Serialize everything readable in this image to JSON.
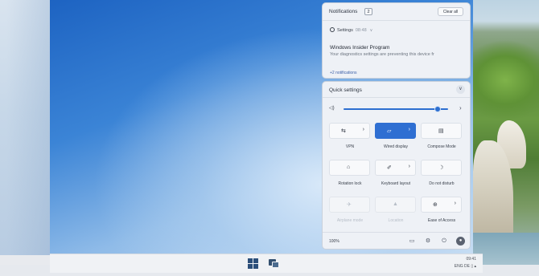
{
  "notifications": {
    "title": "Notifications",
    "count": "2",
    "clear_all": "Clear all",
    "app_name": "Settings",
    "app_time": "08:48",
    "item_title": "Windows Insider Program",
    "item_body": "Your diagnostics settings are preventing this device fr",
    "more": "+2 notifications"
  },
  "quick_settings": {
    "title": "Quick settings",
    "volume_percent": 90,
    "tiles": [
      {
        "name": "vpn",
        "label": "VPN",
        "icon": "shield-icon",
        "glyph": "⇆",
        "has_arrow": true,
        "active": false,
        "disabled": false
      },
      {
        "name": "wired-display",
        "label": "Wired display",
        "icon": "cast-icon",
        "glyph": "▱",
        "has_arrow": true,
        "active": true,
        "disabled": false
      },
      {
        "name": "compose-mode",
        "label": "Compose Mode",
        "icon": "compose-icon",
        "glyph": "▤",
        "has_arrow": false,
        "active": false,
        "disabled": false
      },
      {
        "name": "rotation-lock",
        "label": "Rotation lock",
        "icon": "rotation-lock-icon",
        "glyph": "⌂",
        "has_arrow": false,
        "active": false,
        "disabled": false
      },
      {
        "name": "keyboard-layout",
        "label": "Keyboard layout",
        "icon": "keyboard-icon",
        "glyph": "✐",
        "has_arrow": true,
        "active": false,
        "disabled": false
      },
      {
        "name": "do-not-disturb",
        "label": "Do not disturb",
        "icon": "moon-icon",
        "glyph": "☽",
        "has_arrow": false,
        "active": false,
        "disabled": false
      },
      {
        "name": "airplane-mode",
        "label": "Airplane mode",
        "icon": "airplane-icon",
        "glyph": "✈",
        "has_arrow": false,
        "active": false,
        "disabled": true
      },
      {
        "name": "location",
        "label": "Location",
        "icon": "location-icon",
        "glyph": "▲",
        "has_arrow": false,
        "active": false,
        "disabled": true
      },
      {
        "name": "ease-of-access",
        "label": "Ease of Access",
        "icon": "accessibility-icon",
        "glyph": "⊕",
        "has_arrow": true,
        "active": false,
        "disabled": false
      }
    ],
    "battery": "100%"
  },
  "taskbar": {
    "time": "09:41",
    "lang": "ENG DE"
  }
}
